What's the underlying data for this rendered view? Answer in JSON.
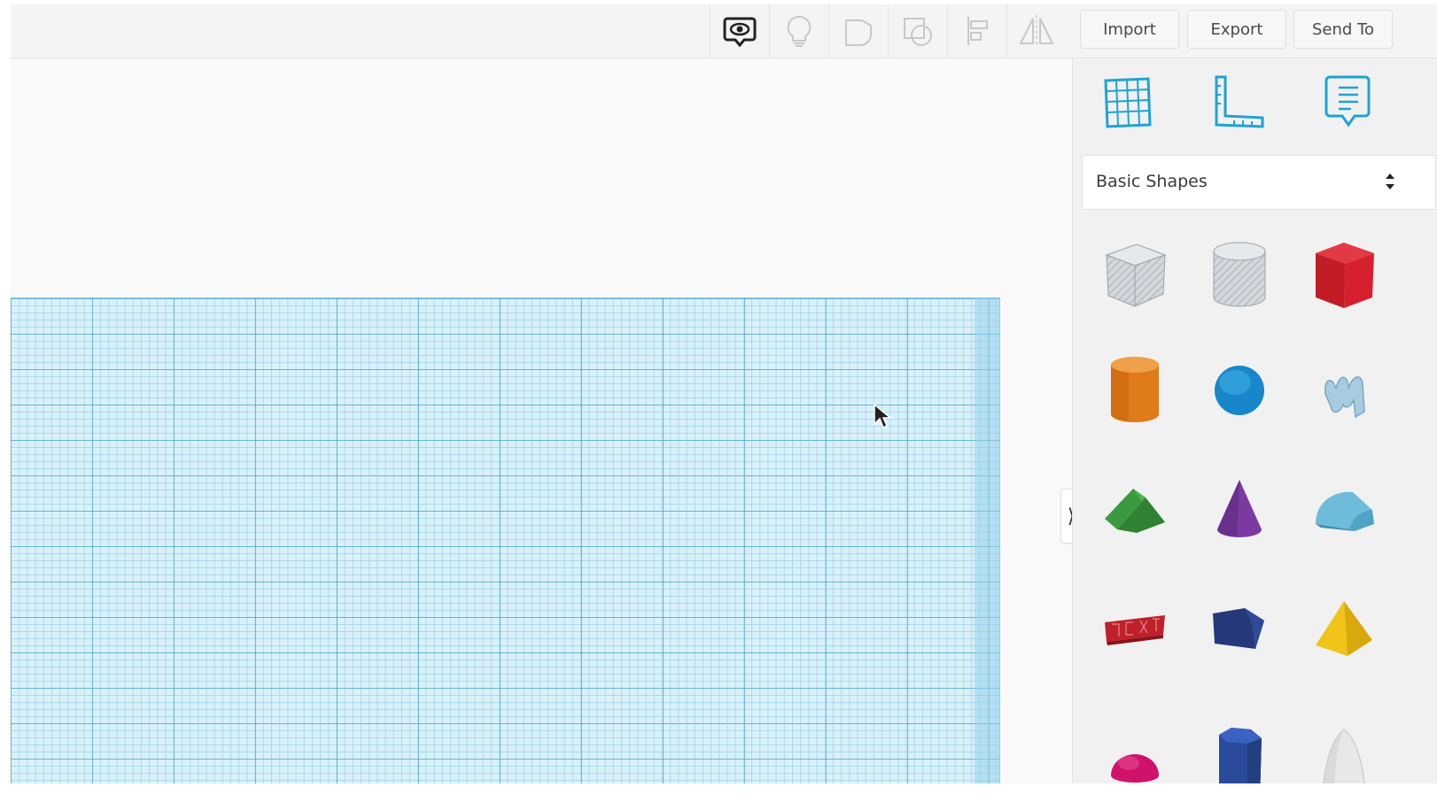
{
  "toolbar": {
    "view_icon": "eye-speech-bubble-icon",
    "icons": [
      "lightbulb-icon",
      "group-icon",
      "ungroup-icon",
      "align-icon",
      "mirror-icon"
    ],
    "import_label": "Import",
    "export_label": "Export",
    "send_to_label": "Send To"
  },
  "panel": {
    "view_icons": [
      "workplane-grid-icon",
      "ruler-icon",
      "notes-icon"
    ],
    "shape_category": {
      "selected": "Basic Shapes"
    },
    "shapes": [
      "box-hole-icon",
      "cylinder-hole-icon",
      "box-icon",
      "cylinder-icon",
      "sphere-icon",
      "scribble-icon",
      "roof-icon",
      "cone-icon",
      "round-roof-icon",
      "text-icon",
      "polygon-icon",
      "pyramid-icon",
      "half-sphere-icon",
      "hexagonal-prism-icon",
      "paraboloid-icon"
    ],
    "collapse_glyph": "⟩"
  },
  "colors": {
    "accent": "#1ea3d2",
    "workplane": "#d9f1fa",
    "grid_major": "#44a0c8",
    "box": "#d6202e",
    "cylinder": "#e07b1a",
    "sphere": "#1787c9",
    "roof": "#3b9a3f",
    "cone": "#7a3aa0",
    "round_roof": "#6dbcd9",
    "text": "#c0202a",
    "polygon": "#24387a",
    "pyramid": "#f0c419",
    "half_sphere": "#d0126b",
    "hex_prism": "#2a4a9a",
    "paraboloid": "#e8e8e8"
  }
}
